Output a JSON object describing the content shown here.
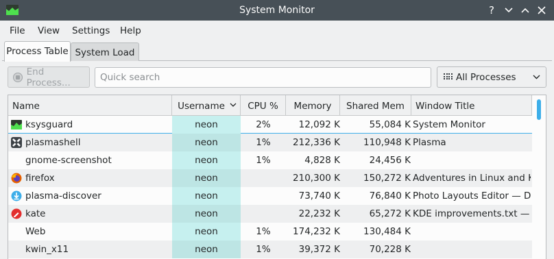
{
  "window": {
    "title": "System Monitor",
    "help_btn": "?",
    "min_btn": "⌄",
    "max_btn": "⌃",
    "close_btn": "✕"
  },
  "menu": [
    "File",
    "View",
    "Settings",
    "Help"
  ],
  "tabs": [
    "Process Table",
    "System Load"
  ],
  "toolbar": {
    "end_process": "End Process...",
    "search_placeholder": "Quick search",
    "filter": "All Processes"
  },
  "columns": [
    "Name",
    "Username",
    "CPU %",
    "Memory",
    "Shared Mem",
    "Window Title"
  ],
  "rows": [
    {
      "name": "ksysguard",
      "icon": "ksysguard-icon",
      "user": "neon",
      "cpu": "2%",
      "mem": "12,092 K",
      "shared": "55,084 K",
      "window": "System Monitor"
    },
    {
      "name": "plasmashell",
      "icon": "plasma-icon",
      "user": "neon",
      "cpu": "1%",
      "mem": "212,336 K",
      "shared": "110,948 K",
      "window": "Plasma"
    },
    {
      "name": "gnome-screenshot",
      "icon": "",
      "user": "neon",
      "cpu": "1%",
      "mem": "4,828 K",
      "shared": "24,456 K",
      "window": ""
    },
    {
      "name": "firefox",
      "icon": "firefox-icon",
      "user": "neon",
      "cpu": "",
      "mem": "210,300 K",
      "shared": "150,272 K",
      "window": "Adventures in Linux and K..."
    },
    {
      "name": "plasma-discover",
      "icon": "discover-icon",
      "user": "neon",
      "cpu": "",
      "mem": "73,740 K",
      "shared": "76,840 K",
      "window": "Photo Layouts Editor — Di..."
    },
    {
      "name": "kate",
      "icon": "kate-icon",
      "user": "neon",
      "cpu": "",
      "mem": "22,232 K",
      "shared": "65,272 K",
      "window": "KDE improvements.txt  — ..."
    },
    {
      "name": "Web",
      "icon": "",
      "user": "neon",
      "cpu": "1%",
      "mem": "174,232 K",
      "shared": "130,484 K",
      "window": ""
    },
    {
      "name": "kwin_x11",
      "icon": "",
      "user": "neon",
      "cpu": "1%",
      "mem": "39,372 K",
      "shared": "70,228 K",
      "window": ""
    }
  ]
}
